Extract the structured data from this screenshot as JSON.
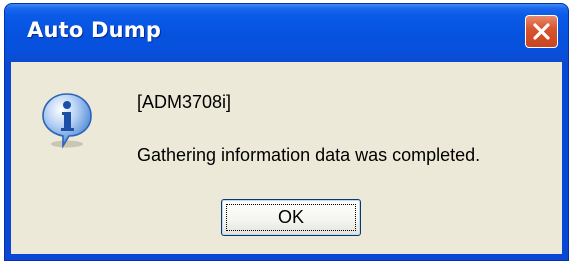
{
  "window": {
    "title": "Auto Dump",
    "close_icon": "close-icon"
  },
  "message": {
    "icon": "info-icon",
    "code": "[ADM3708i]",
    "text": "Gathering information data was completed."
  },
  "buttons": {
    "ok_label": "OK"
  },
  "colors": {
    "titlebar": "#0653e0",
    "close_button": "#d8552f",
    "client_bg": "#ece9d8",
    "info_icon": "#2a6fdb"
  }
}
